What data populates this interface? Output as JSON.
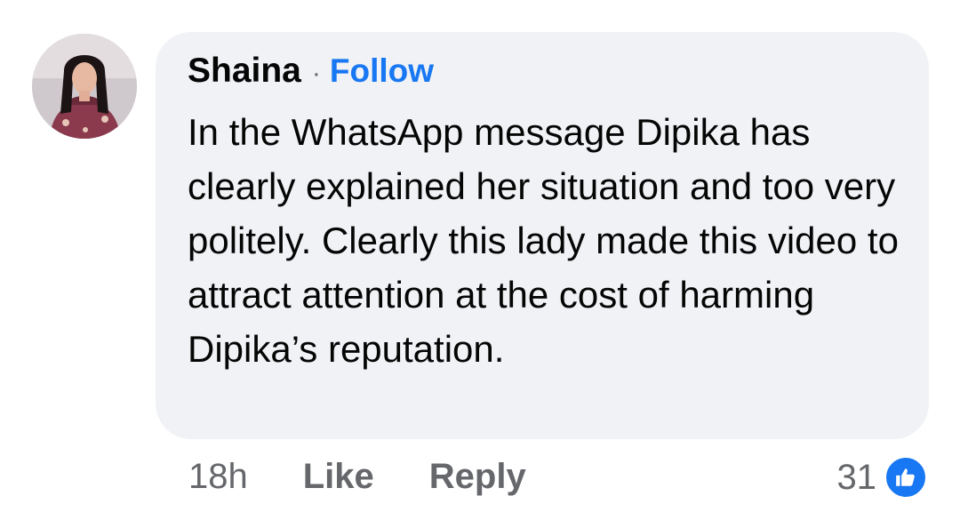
{
  "comment": {
    "author": "Shaina",
    "separator": "·",
    "follow_label": "Follow",
    "text": "In the WhatsApp message Dipika has clearly explained her situation and too very politely. Clearly this lady made this video to attract attention at the cost of harming Dipika’s reputation.",
    "timestamp": "18h",
    "like_label": "Like",
    "reply_label": "Reply",
    "reaction_count": "31",
    "reaction_icon": "thumbs-up-icon",
    "colors": {
      "accent": "#1877f2",
      "bubble": "#f0f2f5",
      "secondary_text": "#65676b",
      "primary_text": "#050505"
    }
  }
}
